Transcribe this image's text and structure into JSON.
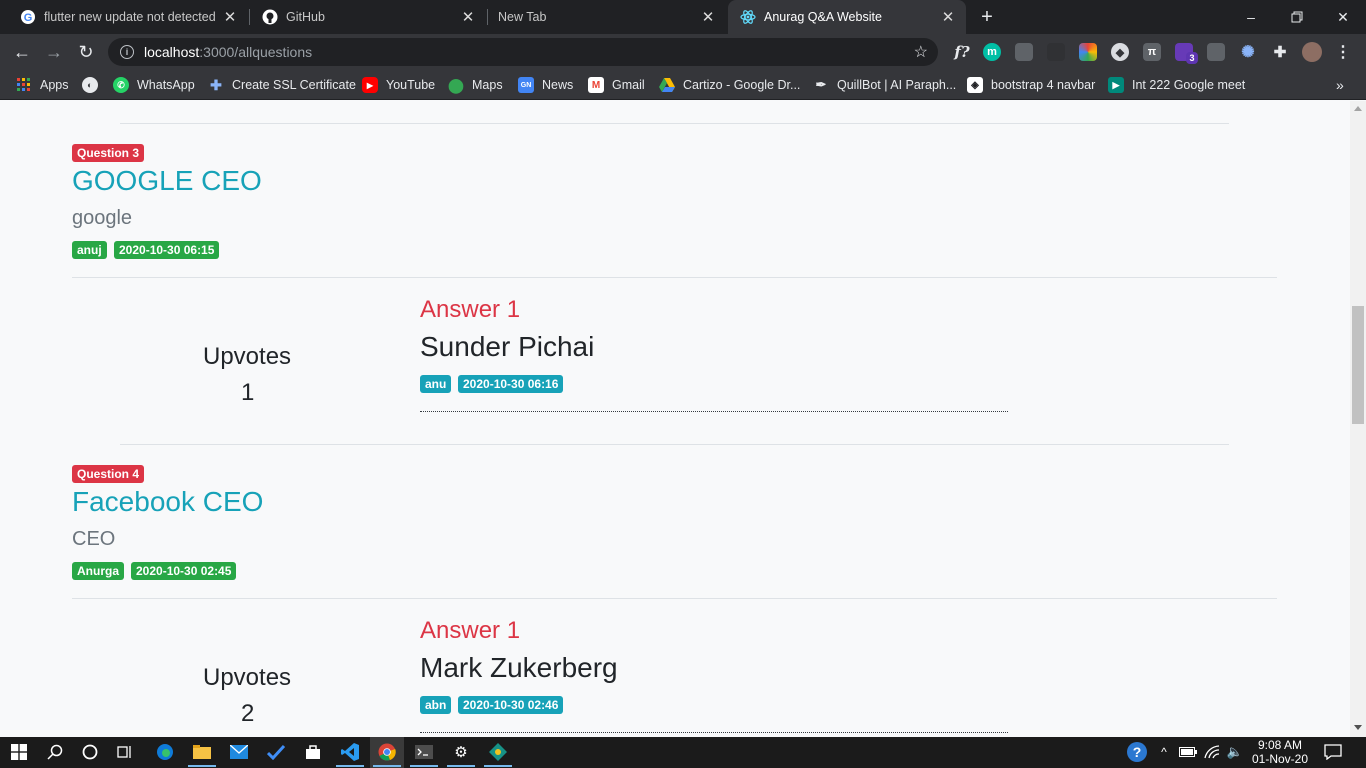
{
  "browser": {
    "tabs": [
      {
        "title": "flutter new update not detected",
        "icon": "google-icon"
      },
      {
        "title": "GitHub",
        "icon": "github-icon"
      },
      {
        "title": "New Tab",
        "icon": ""
      },
      {
        "title": "Anurag Q&A Website",
        "icon": "react-icon",
        "active": true
      }
    ],
    "url_host": "localhost",
    "url_path": ":3000/allquestions",
    "bookmarks": [
      {
        "label": "Apps",
        "icon": "apps-grid-icon"
      },
      {
        "label": "",
        "icon": "globe-icon"
      },
      {
        "label": "WhatsApp",
        "icon": "whatsapp-icon"
      },
      {
        "label": "Create SSL Certificate",
        "icon": "puzzle-icon"
      },
      {
        "label": "YouTube",
        "icon": "youtube-icon"
      },
      {
        "label": "Maps",
        "icon": "maps-icon"
      },
      {
        "label": "News",
        "icon": "news-icon"
      },
      {
        "label": "Gmail",
        "icon": "gmail-icon"
      },
      {
        "label": "Cartizo - Google Dr...",
        "icon": "drive-icon"
      },
      {
        "label": "QuillBot | AI Paraph...",
        "icon": "quill-icon"
      },
      {
        "label": "bootstrap 4 navbar",
        "icon": "codepen-icon"
      },
      {
        "label": "Int 222 Google meet",
        "icon": "meet-icon"
      }
    ],
    "extension_badge": "3"
  },
  "questions": [
    {
      "badge": "Question 3",
      "title": "GOOGLE CEO",
      "description": "google",
      "author": "anuj",
      "date": "2020-10-30 06:15",
      "answers": [
        {
          "label": "Answer 1",
          "text": "Sunder Pichai",
          "author": "anu",
          "date": "2020-10-30 06:16",
          "upvotes_label": "Upvotes",
          "upvotes": "1"
        }
      ]
    },
    {
      "badge": "Question 4",
      "title": "Facebook CEO",
      "description": "CEO",
      "author": "Anurga",
      "date": "2020-10-30 02:45",
      "answers": [
        {
          "label": "Answer 1",
          "text": "Mark Zukerberg",
          "author": "abn",
          "date": "2020-10-30 02:46",
          "upvotes_label": "Upvotes",
          "upvotes": "2"
        }
      ]
    }
  ],
  "taskbar": {
    "time": "9:08 AM",
    "date": "01-Nov-20"
  },
  "colors": {
    "question_badge": "#dc3545",
    "author_badge": "#28a745",
    "answer_badge": "#17a2b8",
    "title": "#17a2b8",
    "answer_label": "#dc3545"
  }
}
